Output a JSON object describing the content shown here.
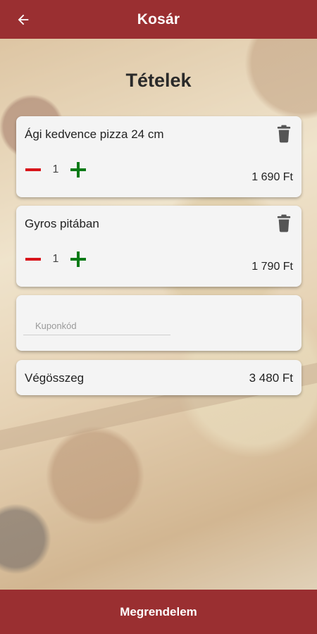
{
  "header": {
    "title": "Kosár",
    "back_icon": "arrow-left-icon",
    "background_color": "#9a2f31"
  },
  "section_title": "Tételek",
  "cart": {
    "items": [
      {
        "name": "Ági kedvence pizza 24 cm",
        "quantity": "1",
        "price": "1 690 Ft"
      },
      {
        "name": "Gyros pitában",
        "quantity": "1",
        "price": "1 790 Ft"
      }
    ],
    "icons": {
      "delete": "trash-icon",
      "decrease": "minus-icon",
      "increase": "plus-icon"
    },
    "colors": {
      "minus": "#d8141a",
      "plus": "#0b7a16",
      "trash": "#555555"
    }
  },
  "coupon": {
    "placeholder": "Kuponkód",
    "value": ""
  },
  "total": {
    "label": "Végösszeg",
    "value": "3 480 Ft"
  },
  "order_button": {
    "label": "Megrendelem"
  }
}
